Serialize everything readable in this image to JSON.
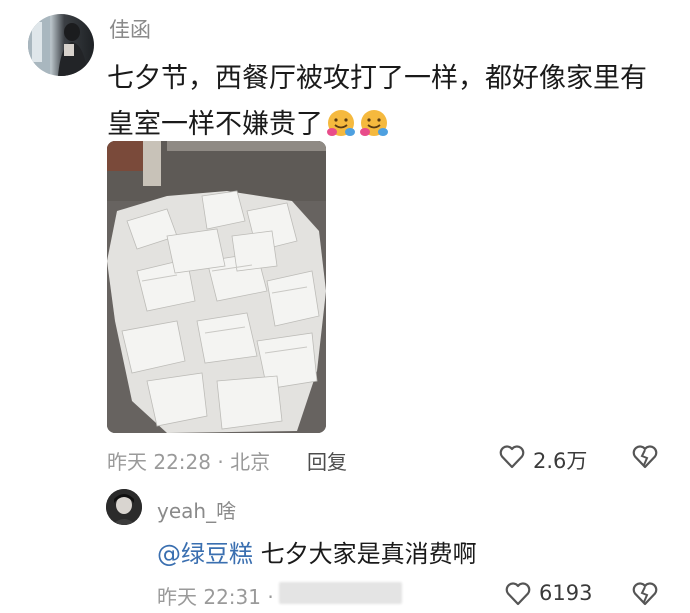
{
  "comment": {
    "username": "佳函",
    "text": "七夕节，西餐厅被攻打了一样，都好像家里有皇室一样不嫌贵了",
    "emoji_icon": "hugging-face-emoji",
    "time_location": "昨天 22:28 · 北京",
    "reply_label": "回复",
    "like_count": "2.6万",
    "like_icon": "heart-outline-icon",
    "dislike_icon": "broken-heart-icon"
  },
  "reply": {
    "username": "yeah_啥",
    "mention": "@绿豆糕",
    "text": "七夕大家是真消费啊",
    "time": "昨天 22:31 ·",
    "like_count": "6193",
    "like_icon": "heart-outline-icon",
    "dislike_icon": "broken-heart-icon"
  },
  "colors": {
    "username": "#8a8a8a",
    "meta": "#9a9a9a",
    "mention": "#3a6fb0",
    "text": "#1a1a1a"
  }
}
